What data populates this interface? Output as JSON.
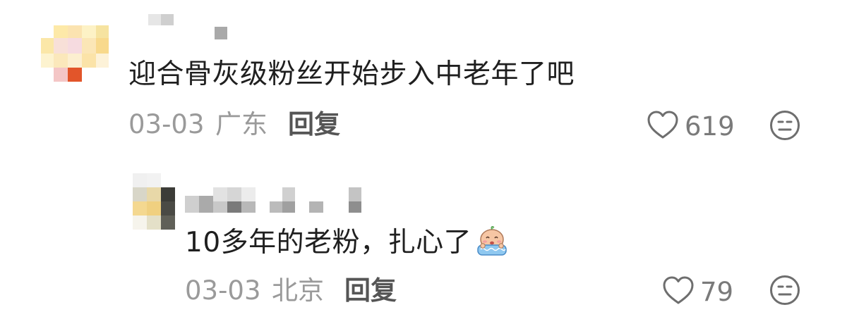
{
  "comments": [
    {
      "text": "迎合骨灰级粉丝开始步入中老年了吧",
      "date": "03-03",
      "location": "广东",
      "reply_label": "回复",
      "likes": "619",
      "icons": {
        "like": "heart-outline-icon",
        "reaction": "neutral-face-icon"
      }
    },
    {
      "text": "10多年的老粉，扎心了",
      "emoji": "crying-bear-emoji",
      "date": "03-03",
      "location": "北京",
      "reply_label": "回复",
      "likes": "79",
      "icons": {
        "like": "heart-outline-icon",
        "reaction": "neutral-face-icon"
      }
    }
  ],
  "colors": {
    "text": "#1f1f1f",
    "meta": "#9a9a9a",
    "reply": "#555555",
    "icon": "#6e6e6e"
  }
}
